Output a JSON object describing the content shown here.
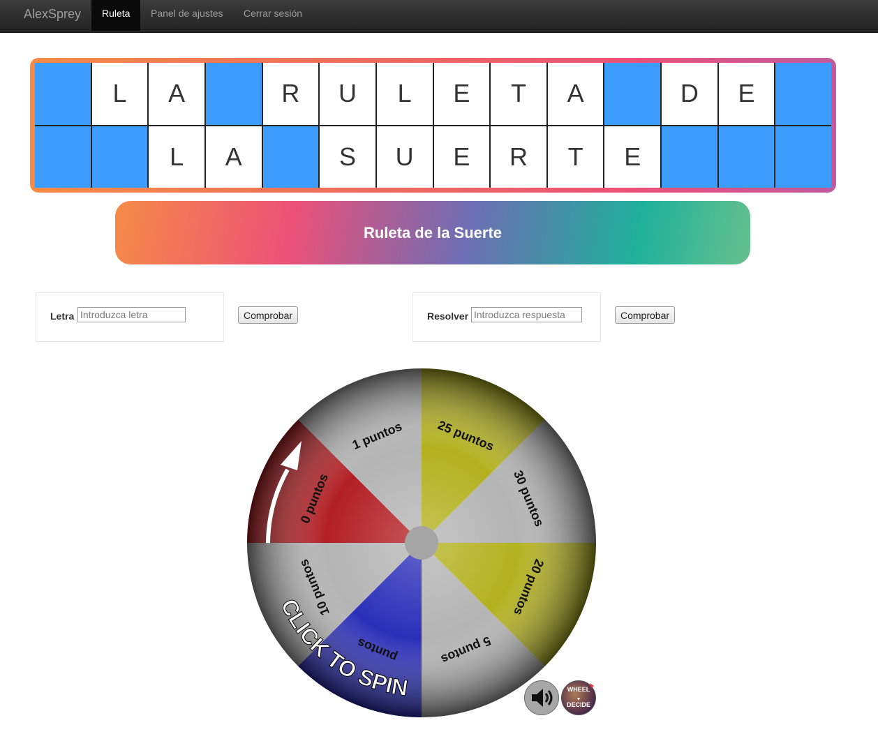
{
  "nav": {
    "brand": "AlexSprey",
    "items": [
      {
        "label": "Ruleta",
        "active": true
      },
      {
        "label": "Panel de ajustes",
        "active": false
      },
      {
        "label": "Cerrar sesión",
        "active": false
      }
    ]
  },
  "board": {
    "colors": {
      "blank": "#3d9dfd",
      "tile": "#ffffff"
    },
    "rows": [
      [
        "",
        "L",
        "A",
        "",
        "R",
        "U",
        "L",
        "E",
        "T",
        "A",
        "",
        "D",
        "E",
        ""
      ],
      [
        "",
        "",
        "L",
        "A",
        "",
        "S",
        "U",
        "E",
        "R",
        "T",
        "E",
        "",
        "",
        ""
      ]
    ]
  },
  "banner": {
    "title": "Ruleta de la Suerte"
  },
  "letter_form": {
    "label": "Letra",
    "placeholder": "Introduzca letra",
    "button": "Comprobar"
  },
  "solve_form": {
    "label": "Resolver",
    "placeholder": "Introduzca respuesta",
    "button": "Comprobar"
  },
  "wheel": {
    "cta": "CLICK TO SPIN",
    "segments": [
      {
        "label": "25 puntos",
        "color": "#b3b11f"
      },
      {
        "label": "30 puntos",
        "color": "#b4b4b4"
      },
      {
        "label": "20 puntos",
        "color": "#b3b11f"
      },
      {
        "label": "5 puntos",
        "color": "#b4b4b4"
      },
      {
        "label": "puntos",
        "color": "#2b2fb8"
      },
      {
        "label": "10 puntos",
        "color": "#b4b4b4"
      },
      {
        "label": "0 puntos",
        "color": "#b21f24"
      },
      {
        "label": "1 puntos",
        "color": "#b4b4b4"
      }
    ],
    "controls": {
      "sound": "speaker-icon",
      "logo_top": "WHEEL",
      "logo_bottom": "DECIDE"
    }
  }
}
